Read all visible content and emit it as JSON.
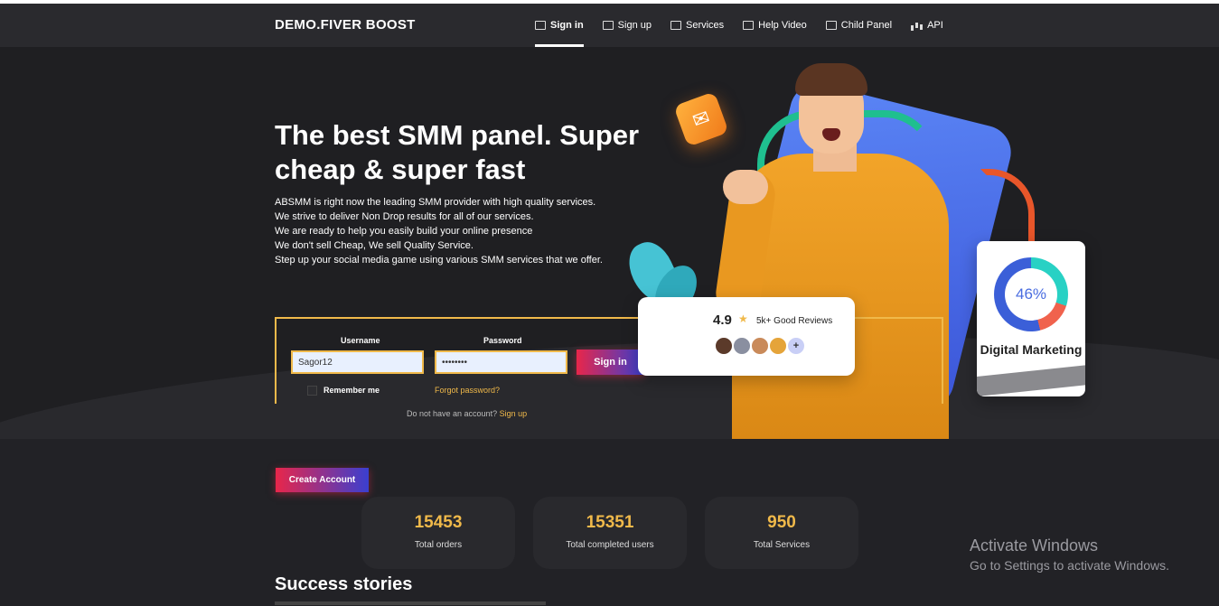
{
  "brand": "DEMO.FIVER BOOST",
  "nav": [
    {
      "label": "Sign in",
      "icon": "id-card-icon",
      "active": true
    },
    {
      "label": "Sign up",
      "icon": "id-card-icon"
    },
    {
      "label": "Services",
      "icon": "list-icon"
    },
    {
      "label": "Help Video",
      "icon": "film-icon"
    },
    {
      "label": "Child Panel",
      "icon": "window-icon"
    },
    {
      "label": "API",
      "icon": "chart-icon"
    }
  ],
  "hero": {
    "headline": "The best SMM panel. Super cheap & super fast",
    "lines": [
      "ABSMM is right now the leading SMM provider with high quality services.",
      "We strive to deliver Non Drop results for all of our services.",
      "We are ready to help you easily build your online presence",
      "We don't sell Cheap, We sell Quality Service.",
      "Step up your social media game using various SMM services that we offer."
    ]
  },
  "login": {
    "username_label": "Username",
    "username_value": "Sagor12",
    "password_label": "Password",
    "password_value": "password",
    "signin_label": "Sign in",
    "remember_label": "Remember me",
    "forgot_label": "Forgot password?",
    "no_account_text": "Do not have an account?",
    "signup_link": "Sign up"
  },
  "review": {
    "score": "4.9",
    "star": "★",
    "text": "5k+ Good Reviews",
    "plus": "+"
  },
  "marketing": {
    "percent": "46%",
    "label": "Digital Marketing"
  },
  "create_account_label": "Create Account",
  "stats": [
    {
      "value": "15453",
      "label": "Total orders"
    },
    {
      "value": "15351",
      "label": "Total completed users"
    },
    {
      "value": "950",
      "label": "Total Services"
    }
  ],
  "success_title": "Success stories",
  "watermark": {
    "title": "Activate Windows",
    "subtitle": "Go to Settings to activate Windows."
  },
  "colors": {
    "accent": "#f0b94a",
    "background": "#222226",
    "button_start": "#e8264a",
    "button_end": "#3a3fd0"
  }
}
